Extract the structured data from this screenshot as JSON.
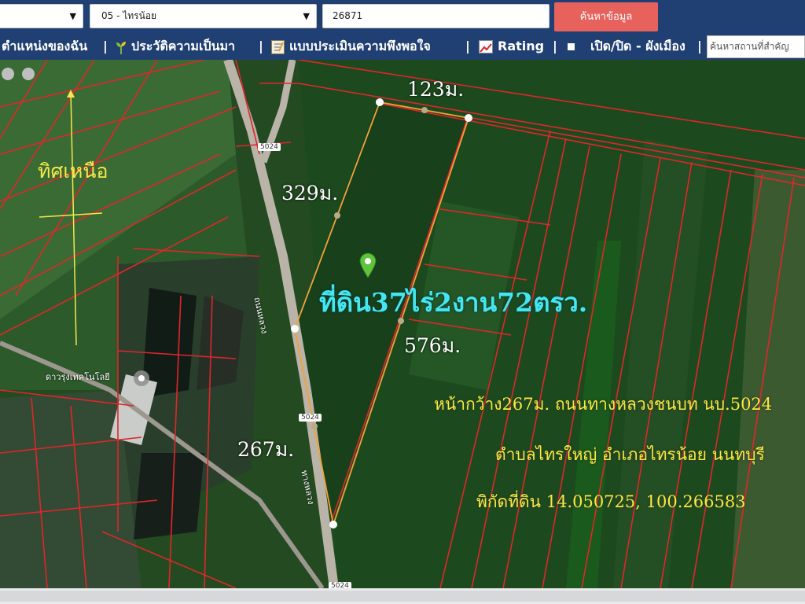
{
  "search": {
    "province_value": "",
    "district_value": "05 - ไทรน้อย",
    "parcel_value": "26871",
    "search_button": "ค้นหาข้อมูล"
  },
  "menu": {
    "my_location": "ตำแหน่งของฉัน",
    "history": "ประวัติความเป็นมา",
    "survey": "แบบประเมินความพึงพอใจ",
    "rating": "Rating",
    "toggle_layer": "เปิด/ปิด - ผังเมือง",
    "poi_placeholder": "ค้นหาสถานที่สำคัญ",
    "separator": "|"
  },
  "map": {
    "north_label": "ทิศเหนือ",
    "dim_top": "123ม.",
    "dim_left": "329ม.",
    "dim_right": "576ม.",
    "dim_bottom": "267ม.",
    "area_label": "ที่ดิน37ไร่2งาน72ตรว.",
    "info_line1": "หน้ากว้าง267ม. ถนนทางหลวงชนบท นบ.5024",
    "info_line2": "ตำบลไทรใหญ่ อำเภอไทรน้อย นนทบุรี",
    "info_line3": "พิกัดที่ดิน 14.050725, 100.266583",
    "place_name": "ดาวรุ่งเทคโนโลยี",
    "road_shield_1": "5024",
    "road_shield_2": "5024",
    "road_shield_3": "5024",
    "road_name_1": "ถนนหลวง",
    "road_name_2": "ทางหลวง",
    "colors": {
      "parcel_line": "#e0262b",
      "boundary": "#f2a23a",
      "area_text": "#45e6ef",
      "info_text": "#f6ec3c",
      "header_bg": "#203f73",
      "search_btn": "#e8625d"
    }
  }
}
